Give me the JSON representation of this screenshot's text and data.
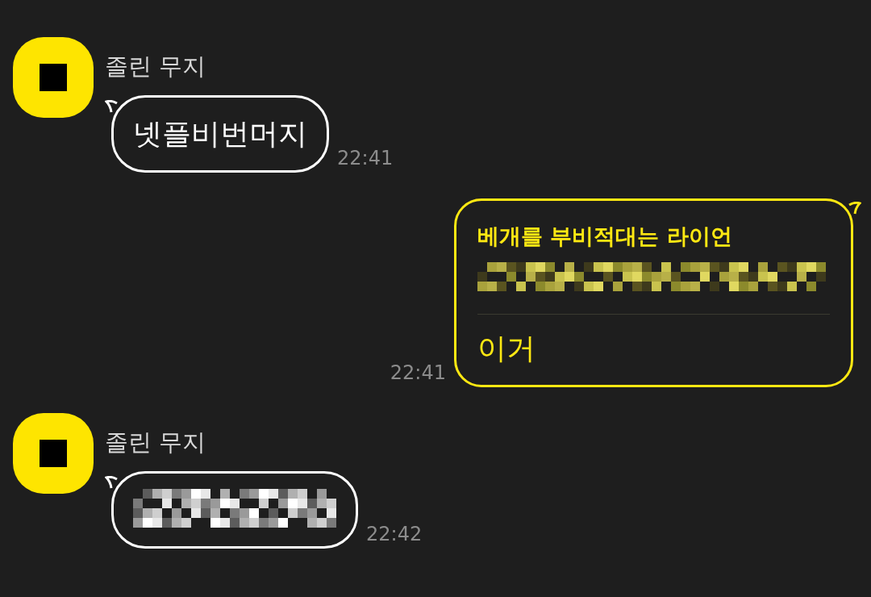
{
  "messages": [
    {
      "kind": "incoming",
      "sender": "졸린 무지",
      "text": "넷플비번머지",
      "time": "22:41"
    },
    {
      "kind": "outgoing",
      "title": "베개를 부비적대는 라이언",
      "mosaic": true,
      "text": "이거",
      "time": "22:41"
    },
    {
      "kind": "incoming",
      "sender": "졸린 무지",
      "mosaic": true,
      "time": "22:42"
    }
  ]
}
